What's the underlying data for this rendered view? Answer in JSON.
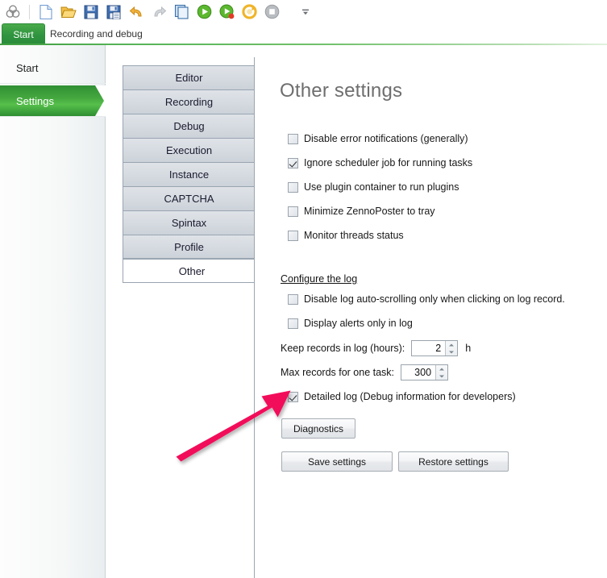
{
  "toolbar": {
    "icons": [
      {
        "name": "zenno-logo-icon",
        "glyph": "logo"
      },
      {
        "name": "new-file-icon",
        "glyph": "new"
      },
      {
        "name": "open-folder-icon",
        "glyph": "open"
      },
      {
        "name": "save-icon",
        "glyph": "save"
      },
      {
        "name": "save-as-icon",
        "glyph": "saveas"
      },
      {
        "name": "undo-icon",
        "glyph": "undo"
      },
      {
        "name": "redo-icon",
        "glyph": "redo"
      },
      {
        "name": "copy-project-icon",
        "glyph": "copy"
      },
      {
        "name": "run-icon",
        "glyph": "run"
      },
      {
        "name": "run-debug-icon",
        "glyph": "rundebug"
      },
      {
        "name": "restart-icon",
        "glyph": "restart"
      },
      {
        "name": "stop-icon",
        "glyph": "stop"
      },
      {
        "name": "overflow-menu-icon",
        "glyph": "overflow"
      }
    ]
  },
  "ribbon": {
    "tabs": [
      {
        "label": "Start",
        "active": true
      },
      {
        "label": "Recording and debug",
        "active": false
      }
    ]
  },
  "sidebar": {
    "items": [
      {
        "label": "Start",
        "selected": false
      },
      {
        "label": "Settings",
        "selected": true
      }
    ]
  },
  "settings_tabs": [
    {
      "label": "Editor",
      "selected": false
    },
    {
      "label": "Recording",
      "selected": false
    },
    {
      "label": "Debug",
      "selected": false
    },
    {
      "label": "Execution",
      "selected": false
    },
    {
      "label": "Instance",
      "selected": false
    },
    {
      "label": "CAPTCHA",
      "selected": false
    },
    {
      "label": "Spintax",
      "selected": false
    },
    {
      "label": "Profile",
      "selected": false
    },
    {
      "label": "Other",
      "selected": true
    }
  ],
  "panel": {
    "title": "Other settings",
    "checkboxes": [
      {
        "label": "Disable error notifications (generally)",
        "checked": false
      },
      {
        "label": "Ignore scheduler job for running tasks",
        "checked": true
      },
      {
        "label": "Use plugin container to run plugins",
        "checked": false
      },
      {
        "label": "Minimize ZennoPoster to tray",
        "checked": false
      },
      {
        "label": "Monitor threads status",
        "checked": false
      }
    ],
    "log_section": {
      "heading": "Configure the log",
      "checkboxes": [
        {
          "label": "Disable log auto-scrolling only when clicking on log record.",
          "checked": false
        },
        {
          "label": "Display alerts only in log",
          "checked": false
        }
      ],
      "numeric_fields": [
        {
          "label": "Keep records in log (hours):",
          "value": "2",
          "unit": "h"
        },
        {
          "label": "Max records for one task:",
          "value": "300",
          "unit": ""
        }
      ],
      "detailed_log": {
        "label": "Detailed log (Debug information for developers)",
        "checked": true
      }
    },
    "buttons": {
      "diagnostics": "Diagnostics",
      "save_settings": "Save settings",
      "restore_settings": "Restore settings"
    }
  },
  "annotation": {
    "arrow_color": "#F2105A",
    "name": "highlight-arrow"
  },
  "colors": {
    "accent_green": "#2f9440",
    "tab_gray": "#d6dbe1",
    "title_gray": "#6e6e6e"
  }
}
